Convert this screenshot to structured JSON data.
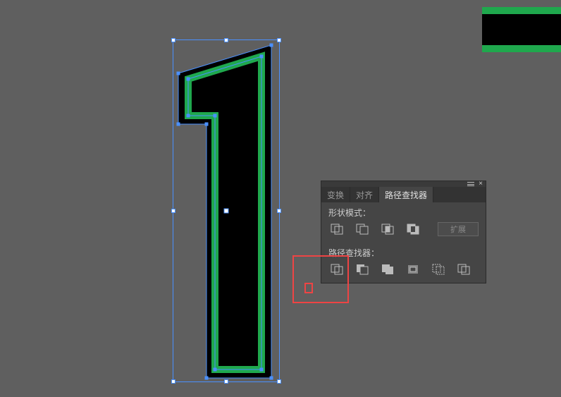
{
  "panel": {
    "tabs": {
      "transform": "变换",
      "align": "对齐",
      "pathfinder": "路径查找器"
    },
    "shape_modes_label": "形状模式：",
    "pathfinders_label": "路径查找器：",
    "expand_label": "扩展",
    "shape_mode_icons": [
      "unite",
      "minus-front",
      "intersect",
      "exclude"
    ],
    "pathfinder_icons": [
      "divide",
      "trim",
      "merge",
      "crop",
      "outline",
      "minus-back"
    ]
  },
  "colors": {
    "green": "#1fa84d",
    "black": "#000000",
    "selection": "#4a90ff",
    "highlight": "#e44"
  },
  "artwork": {
    "type": "numeral-1-shape",
    "selected": true
  }
}
